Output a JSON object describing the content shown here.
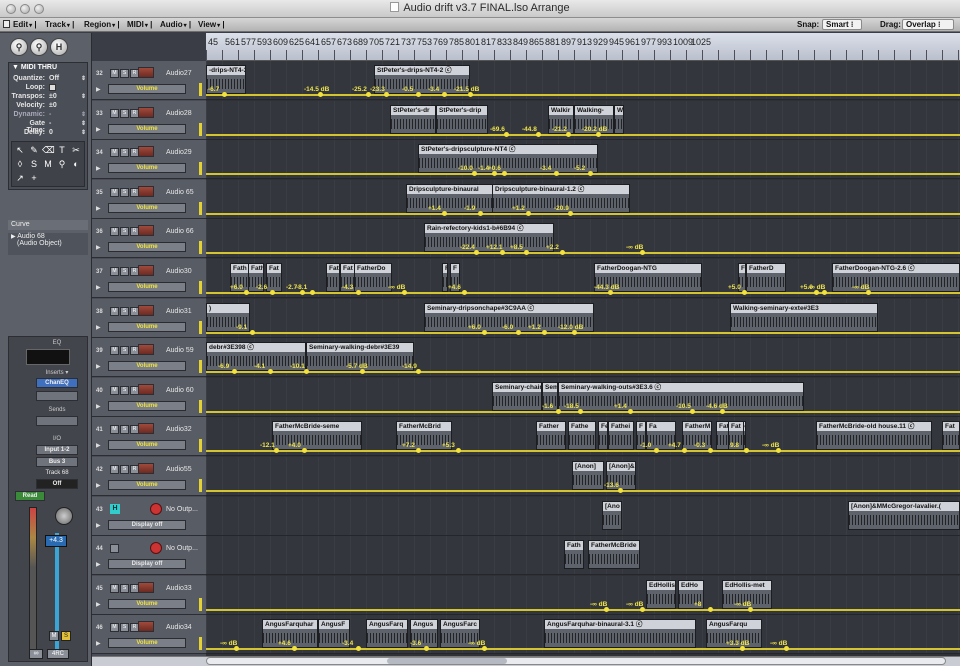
{
  "window": {
    "title": "Audio drift v3.7 FINAL.lso Arrange"
  },
  "toolbar": {
    "menus": [
      "Edit",
      "Track",
      "Region",
      "MIDI",
      "Audio",
      "View"
    ],
    "snap_label": "Snap:",
    "snap_value": "Smart",
    "drag_label": "Drag:",
    "drag_value": "Overlap"
  },
  "ruler": {
    "bars": [
      "45",
      "561",
      "577",
      "593",
      "609",
      "625",
      "641",
      "657",
      "673",
      "689",
      "705",
      "721",
      "737",
      "753",
      "769",
      "785",
      "801",
      "817",
      "833",
      "849",
      "865",
      "881",
      "897",
      "913",
      "929",
      "945",
      "961",
      "977",
      "993",
      "1009",
      "1025"
    ]
  },
  "inspector": {
    "header": "MIDI THRU",
    "params": [
      {
        "k": "Quantize:",
        "v": "Off"
      },
      {
        "k": "Loop:",
        "v": ""
      },
      {
        "k": "Transpos:",
        "v": "±0"
      },
      {
        "k": "Velocity:",
        "v": "±0"
      },
      {
        "k": "Dynamic:",
        "v": "-"
      },
      {
        "k": "Gate Time:",
        "v": "-"
      },
      {
        "k": "Delay:",
        "v": "0"
      }
    ],
    "curve_label": "Curve",
    "object_name": "Audio 68",
    "object_type": "(Audio Object)",
    "strip": {
      "eq": "EQ",
      "inserts": "Inserts",
      "chaneq": "ChanEQ",
      "sends": "Sends",
      "io": "I/O",
      "input": "Input 1-2",
      "bus": "Bus 3",
      "track": "Track 68",
      "off": "Off",
      "read": "Read",
      "vol": "+4.3",
      "mute": "M",
      "solo": "S",
      "link": "∞",
      "mode": "4RC"
    }
  },
  "tracks": [
    {
      "num": "32",
      "name": "Audio27",
      "auto": "Volume"
    },
    {
      "num": "33",
      "name": "Audio28",
      "auto": "Volume"
    },
    {
      "num": "34",
      "name": "Audio29",
      "auto": "Volume"
    },
    {
      "num": "35",
      "name": "Audio 65",
      "auto": "Volume"
    },
    {
      "num": "36",
      "name": "Audio 66",
      "auto": "Volume"
    },
    {
      "num": "37",
      "name": "Audio30",
      "auto": "Volume"
    },
    {
      "num": "38",
      "name": "Audio31",
      "auto": "Volume"
    },
    {
      "num": "39",
      "name": "Audio 59",
      "auto": "Volume"
    },
    {
      "num": "40",
      "name": "Audio 60",
      "auto": "Volume"
    },
    {
      "num": "41",
      "name": "Audio32",
      "auto": "Volume"
    },
    {
      "num": "42",
      "name": "Audio55",
      "auto": "Volume"
    },
    {
      "num": "43",
      "name": "No Outp...",
      "auto": "Display off"
    },
    {
      "num": "44",
      "name": "No Outp...",
      "auto": "Display off"
    },
    {
      "num": "45",
      "name": "Audio33",
      "auto": "Volume"
    },
    {
      "num": "46",
      "name": "Audio34",
      "auto": "Volume"
    }
  ],
  "regions": [
    {
      "lane": 0,
      "label": "-drips-NT4-3 ⓒ"
    },
    {
      "lane": 0,
      "label": "StPeter's-drips-NT4-2 ⓒ"
    },
    {
      "lane": 1,
      "label": "StPeter's-dr"
    },
    {
      "lane": 1,
      "label": "StPeter's-drip"
    },
    {
      "lane": 1,
      "label": "Walkir"
    },
    {
      "lane": 1,
      "label": "Walking-"
    },
    {
      "lane": 1,
      "label": "W"
    },
    {
      "lane": 2,
      "label": "StPeter's-dripsculpture-NT4 ⓒ"
    },
    {
      "lane": 3,
      "label": "Dripsculpture-binaural"
    },
    {
      "lane": 3,
      "label": "Dripsculpture-binaural-1.2 ⓒ"
    },
    {
      "lane": 4,
      "label": "Rain-refectory-kids1-b#6B94 ⓒ"
    },
    {
      "lane": 5,
      "label": "Fath"
    },
    {
      "lane": 5,
      "label": "Fath"
    },
    {
      "lane": 5,
      "label": "Fat"
    },
    {
      "lane": 5,
      "label": "Fat"
    },
    {
      "lane": 5,
      "label": "Fat"
    },
    {
      "lane": 5,
      "label": "FatherDo"
    },
    {
      "lane": 5,
      "label": "F"
    },
    {
      "lane": 5,
      "label": "F"
    },
    {
      "lane": 5,
      "label": "FatherDoogan-NTG"
    },
    {
      "lane": 5,
      "label": "F"
    },
    {
      "lane": 5,
      "label": "FatherD"
    },
    {
      "lane": 5,
      "label": "FatherDoogan-NTG-2.6 ⓒ"
    },
    {
      "lane": 6,
      "label": ")"
    },
    {
      "lane": 6,
      "label": "Seminary-dripsonchape#3C9AA ⓒ"
    },
    {
      "lane": 6,
      "label": "Walking-seminary-exte#3E3"
    },
    {
      "lane": 7,
      "label": "debr#3E398 ⓒ"
    },
    {
      "lane": 7,
      "label": "Seminary-walking-debr#3E39"
    },
    {
      "lane": 8,
      "label": "Seminary-chainstream"
    },
    {
      "lane": 8,
      "label": "Sem"
    },
    {
      "lane": 8,
      "label": "Seminary-walking-outs#3E3.6 ⓒ"
    },
    {
      "lane": 9,
      "label": "FatherMcBride-seme"
    },
    {
      "lane": 9,
      "label": "FatherMcBrid"
    },
    {
      "lane": 9,
      "label": "Father"
    },
    {
      "lane": 9,
      "label": "Fathe"
    },
    {
      "lane": 9,
      "label": "Fe"
    },
    {
      "lane": 9,
      "label": "Fathei"
    },
    {
      "lane": 9,
      "label": "F"
    },
    {
      "lane": 9,
      "label": "Fa"
    },
    {
      "lane": 9,
      "label": "FatherM"
    },
    {
      "lane": 9,
      "label": "FatherMc"
    },
    {
      "lane": 9,
      "label": "Fat"
    },
    {
      "lane": 9,
      "label": "FatherMcBride-old house.11 ⓒ"
    },
    {
      "lane": 9,
      "label": "Fat"
    },
    {
      "lane": 10,
      "label": "[Anon]"
    },
    {
      "lane": 10,
      "label": "[Anon]&"
    },
    {
      "lane": 11,
      "label": "[Ano"
    },
    {
      "lane": 11,
      "label": "[Anon]&MMcGregor-lavalier.("
    },
    {
      "lane": 12,
      "label": "Fath"
    },
    {
      "lane": 12,
      "label": "FatherMcBride"
    },
    {
      "lane": 13,
      "label": "EdHollis"
    },
    {
      "lane": 13,
      "label": "EdHo"
    },
    {
      "lane": 13,
      "label": "EdHollis-met"
    },
    {
      "lane": 14,
      "label": "AngusFarquhar"
    },
    {
      "lane": 14,
      "label": "AngusF"
    },
    {
      "lane": 14,
      "label": "AngusFarq"
    },
    {
      "lane": 14,
      "label": "Angus"
    },
    {
      "lane": 14,
      "label": "AngusFarc"
    },
    {
      "lane": 14,
      "label": "AngusFarquhar-binaural-3.1 ⓒ"
    },
    {
      "lane": 14,
      "label": "AngusFarqu"
    }
  ],
  "db_labels": [
    "-6.7",
    "-14.5 dB",
    "-25.2",
    "-23.3",
    "-0.5",
    "-3.4",
    "-21.5 dB",
    "-69.6",
    "-44.8",
    "-21.2",
    "-20.2 dB",
    "-10.0",
    "-1.4",
    "-3.4",
    "+0.6",
    "-5.2",
    "+1.4",
    "-1.9",
    "+1.2",
    "-20.9",
    "-22.4",
    "+12.1",
    "+8.5",
    "+2.2",
    "-∞ dB",
    "+6.0",
    "-2.6",
    "-2.7",
    "-8.1",
    "-4.3",
    "-∞ dB",
    "+4.6",
    "+5.0",
    "-44.3 dB",
    "-∞ dB",
    "+5.0",
    "-∞ dB",
    "-9.1",
    "+6.0",
    "-6.0",
    "+1.2",
    "-12.0 dB",
    "-6.9",
    "-4.1",
    "-10.1",
    "-5.7 dB",
    "-14.9",
    "-1.6",
    "-18.5",
    "+1.4",
    "-10.5",
    "-4.6 dB",
    "-12.1",
    "+4.0",
    "+7.2",
    "+5.3",
    "-1.0",
    "+4.7",
    "-0.3",
    "9.8",
    "-∞ dB",
    "-13.6",
    "-∞ dB",
    "-∞ dB",
    "+8",
    "-∞ dB",
    "-∞ dB",
    "+4.6",
    "-3.4",
    "-3.6",
    "-∞ dB",
    "+3.3 dB",
    "-∞ dB"
  ]
}
